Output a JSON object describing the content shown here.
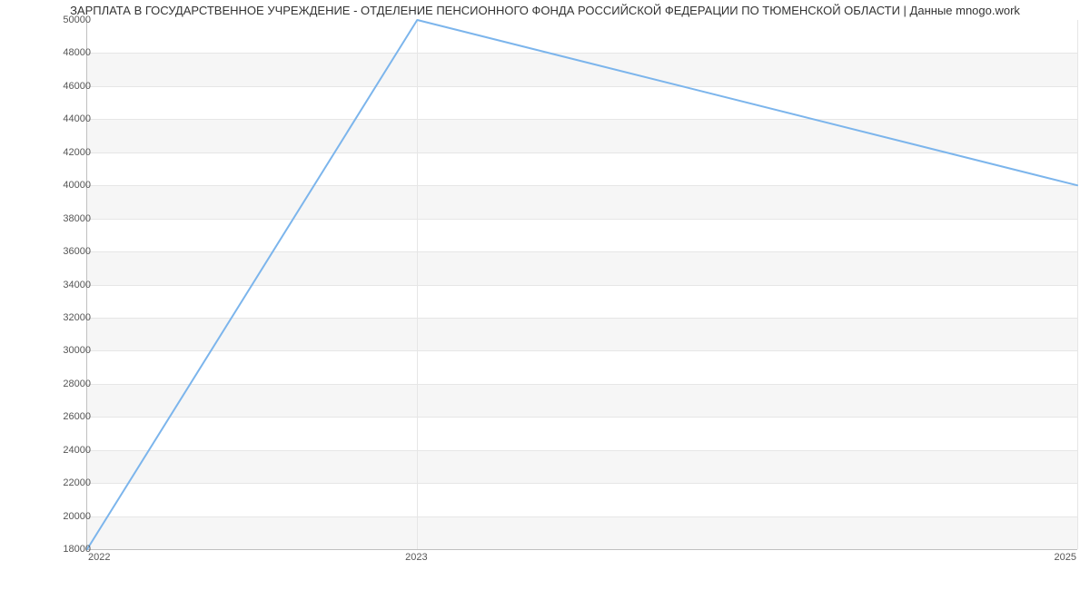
{
  "title": "ЗАРПЛАТА В ГОСУДАРСТВЕННОЕ УЧРЕЖДЕНИЕ - ОТДЕЛЕНИЕ ПЕНСИОННОГО ФОНДА РОССИЙСКОЙ ФЕДЕРАЦИИ ПО ТЮМЕНСКОЙ ОБЛАСТИ | Данные mnogo.work",
  "chart_data": {
    "type": "line",
    "x": [
      2022,
      2023,
      2025
    ],
    "values": [
      18000,
      50000,
      40000
    ],
    "title": "ЗАРПЛАТА В ГОСУДАРСТВЕННОЕ УЧРЕЖДЕНИЕ - ОТДЕЛЕНИЕ ПЕНСИОННОГО ФОНДА РОССИЙСКОЙ ФЕДЕРАЦИИ ПО ТЮМЕНСКОЙ ОБЛАСТИ | Данные mnogo.work",
    "xlabel": "",
    "ylabel": "",
    "xlim": [
      2022,
      2025
    ],
    "ylim": [
      18000,
      50000
    ],
    "yticks": [
      18000,
      20000,
      22000,
      24000,
      26000,
      28000,
      30000,
      32000,
      34000,
      36000,
      38000,
      40000,
      42000,
      44000,
      46000,
      48000,
      50000
    ],
    "xticks": [
      2022,
      2023,
      2025
    ],
    "grid": true,
    "series_color": "#7cb5ec"
  }
}
